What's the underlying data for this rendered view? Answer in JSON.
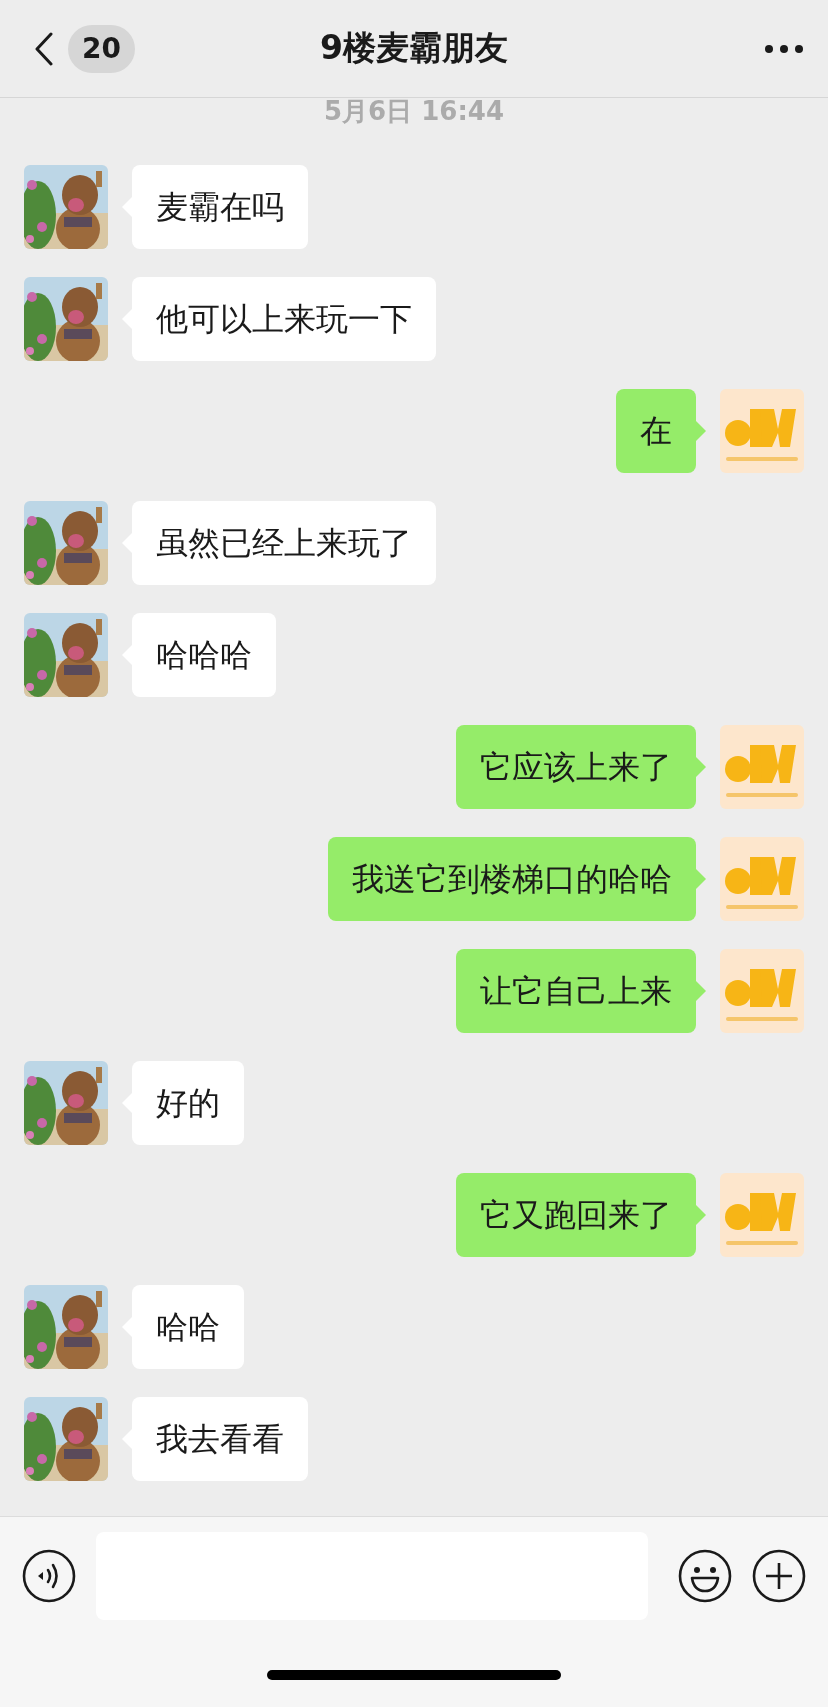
{
  "header": {
    "back_count": "20",
    "title": "9楼麦霸朋友"
  },
  "timestamp": "5月6日 16:44",
  "messages": [
    {
      "kind": "incoming",
      "text": "麦霸在吗"
    },
    {
      "kind": "incoming",
      "text": "他可以上来玩一下"
    },
    {
      "kind": "outgoing",
      "text": "在"
    },
    {
      "kind": "incoming",
      "text": "虽然已经上来玩了"
    },
    {
      "kind": "incoming",
      "text": "哈哈哈"
    },
    {
      "kind": "outgoing",
      "text": "它应该上来了"
    },
    {
      "kind": "outgoing",
      "text": "我送它到楼梯口的哈哈"
    },
    {
      "kind": "outgoing",
      "text": "让它自己上来"
    },
    {
      "kind": "incoming",
      "text": "好的"
    },
    {
      "kind": "outgoing",
      "text": "它又跑回来了"
    },
    {
      "kind": "incoming",
      "text": "哈哈"
    },
    {
      "kind": "incoming",
      "text": "我去看看"
    }
  ]
}
